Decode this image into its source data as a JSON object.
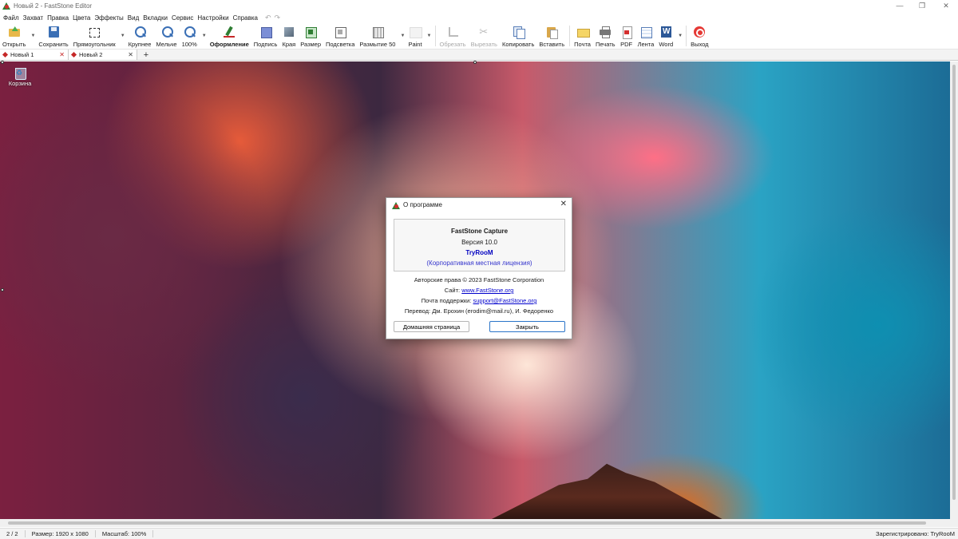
{
  "window": {
    "title": "Новый 2 - FastStone Editor",
    "controls": [
      "—",
      "❐",
      "✕"
    ]
  },
  "menu": {
    "items": [
      "Файл",
      "Захват",
      "Правка",
      "Цвета",
      "Эффекты",
      "Вид",
      "Вкладки",
      "Сервис",
      "Настройки",
      "Справка"
    ],
    "undo": "↶",
    "redo": "↷"
  },
  "toolbar": {
    "open": "Открыть",
    "save": "Сохранить",
    "rect": "Прямоугольник",
    "zoomin": "Крупнее",
    "zoomout": "Мельче",
    "zoom100": "100%",
    "draw": "Оформление",
    "caption": "Подпись",
    "edge": "Края",
    "resize": "Размер",
    "spotlight": "Подсветка",
    "blur": "Размытие 50",
    "paint": "Paint",
    "crop": "Обрезать",
    "cut": "Вырезать",
    "copy": "Копировать",
    "paste": "Вставить",
    "email": "Почта",
    "print": "Печать",
    "pdf": "PDF",
    "ribbon": "Лента",
    "word": "Word",
    "exit": "Выход"
  },
  "tabs": {
    "items": [
      "Новый 1",
      "Новый 2"
    ],
    "add": "+"
  },
  "desktop": {
    "recycle_bin": "Корзина"
  },
  "status": {
    "page": "2 / 2",
    "size": "Размер: 1920 x 1080",
    "scale": "Масштаб: 100%",
    "registered": "Зарегистрировано: TryRooM"
  },
  "dialog": {
    "title": "О программе",
    "product": "FastStone Capture",
    "version": "Версия 10.0",
    "user": "TryRooM",
    "license": "(Корпоративная местная лицензия)",
    "copyright": "Авторские права © 2023 FastStone Corporation",
    "site_label": "Сайт:",
    "site": "www.FastStone.org",
    "support_label": "Почта поддержки:",
    "support": "support@FastStone.org",
    "translation": "Перевод: Дм. Ерохин (erodim@mail.ru), И. Федоренко",
    "homepage_button": "Домашняя страница",
    "close_button": "Закрыть"
  }
}
